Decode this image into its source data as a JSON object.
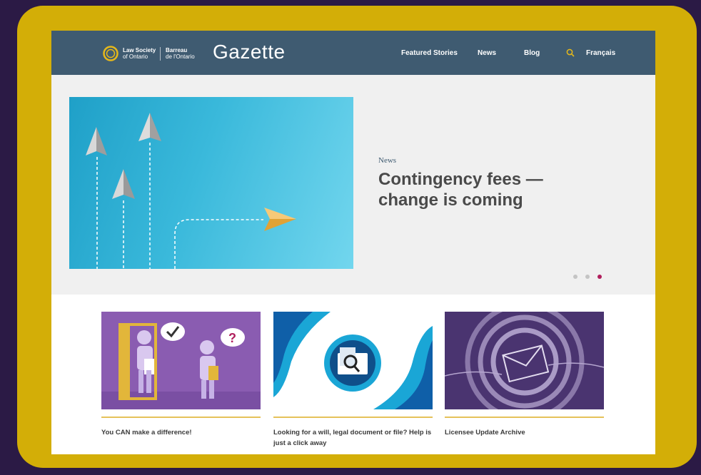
{
  "header": {
    "logo_en_line1": "Law Society",
    "logo_en_line2": "of Ontario",
    "logo_fr_line1": "Barreau",
    "logo_fr_line2": "de l'Ontario",
    "site_title": "Gazette",
    "nav": {
      "featured": "Featured Stories",
      "news": "News",
      "blog": "Blog",
      "language": "Français"
    },
    "search_icon": "search-icon"
  },
  "hero": {
    "category": "News",
    "headline": "Contingency fees — change is coming",
    "image": "paper-planes-illustration",
    "slides": 3,
    "active_slide": 3
  },
  "cards": [
    {
      "title": "You CAN make a difference!",
      "image": "people-speech-bubbles-illustration"
    },
    {
      "title": "Looking for a will, legal document or file? Help is just a click away",
      "image": "document-search-illustration"
    },
    {
      "title": "Licensee Update Archive",
      "image": "envelope-circles-illustration"
    }
  ],
  "colors": {
    "background": "#2b1a45",
    "frame": "#d3ae07",
    "header": "#3f5b71",
    "accent_dot": "#b01e5c",
    "card_rule": "#e5c25a"
  }
}
